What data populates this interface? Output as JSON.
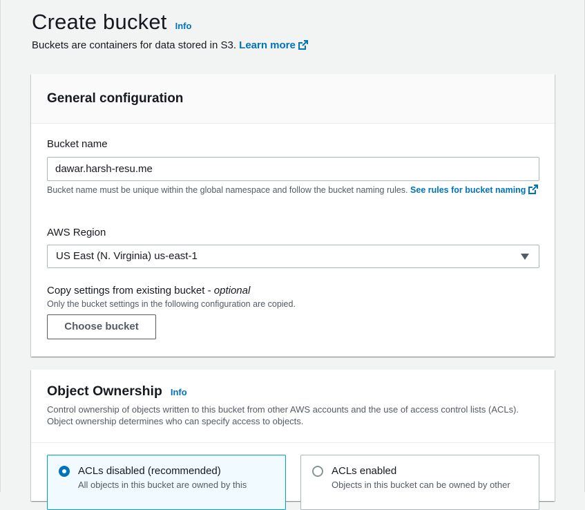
{
  "header": {
    "title": "Create bucket",
    "info": "Info",
    "description": "Buckets are containers for data stored in S3.",
    "learn_more": "Learn more"
  },
  "general": {
    "title": "General configuration",
    "bucket_name_label": "Bucket name",
    "bucket_name_value": "dawar.harsh-resu.me",
    "bucket_name_help": "Bucket name must be unique within the global namespace and follow the bucket naming rules.",
    "bucket_name_help_link": "See rules for bucket naming",
    "region_label": "AWS Region",
    "region_value": "US East (N. Virginia) us-east-1",
    "copy_label": "Copy settings from existing bucket - ",
    "copy_optional": "optional",
    "copy_help": "Only the bucket settings in the following configuration are copied.",
    "choose_bucket": "Choose bucket"
  },
  "ownership": {
    "title": "Object Ownership",
    "info": "Info",
    "description": "Control ownership of objects written to this bucket from other AWS accounts and the use of access control lists (ACLs). Object ownership determines who can specify access to objects.",
    "options": [
      {
        "label": "ACLs disabled (recommended)",
        "description": "All objects in this bucket are owned by this",
        "selected": true
      },
      {
        "label": "ACLs enabled",
        "description": "Objects in this bucket can be owned by other",
        "selected": false
      }
    ]
  },
  "colors": {
    "link": "#0073bb",
    "selected_border": "#00a1c9",
    "text": "#16191f"
  },
  "icons": {
    "external": "external-link-icon",
    "caret": "caret-down-icon"
  }
}
